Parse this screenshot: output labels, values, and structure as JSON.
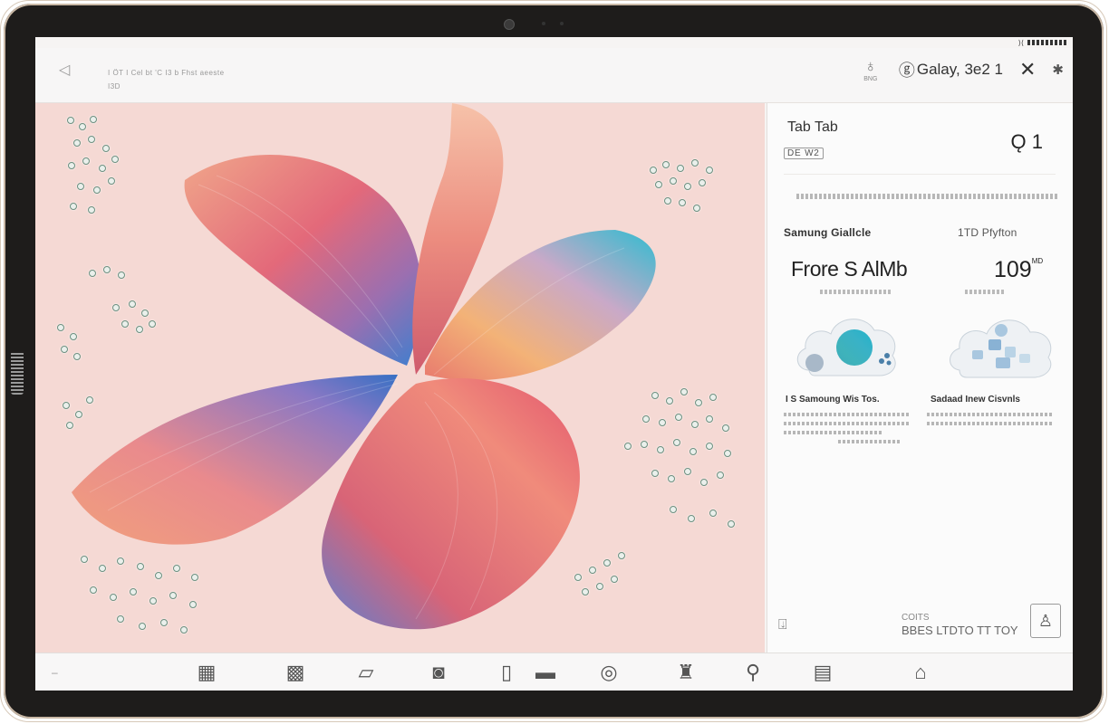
{
  "status_bar": {
    "battery": "▮▮▮▮"
  },
  "top_bar": {
    "back_icon": "back-arrow-icon",
    "breadcrumb_line1": "I ÖT I Cel bt 'C I3 b Fhst aeeste",
    "breadcrumb_line2": "I3D",
    "tip_label": "BNG",
    "account_label": "Galay, 3e2 1"
  },
  "panel": {
    "title": "Tab Tab",
    "badge": "DE W2",
    "count": "1",
    "col_left": "Samung Giallcle",
    "col_right": "1TD Pfyfton",
    "device_name": "Frore S AlMb",
    "device_value": "109",
    "device_value_unit": "MD",
    "card1_title": "I S Samoung Wis Tos.",
    "card2_title": "Sadaad Inew Cisvnls",
    "footer_line1": "COITS",
    "footer_line2": "BBES LTDTO TT TOY"
  },
  "colors": {
    "canvas_bg": "#f5d9d4",
    "bezel": "#1e1c1b",
    "accent_teal": "#1fb3c7"
  },
  "dock": {
    "icons": [
      "grid-icon",
      "table-icon",
      "folder-icon",
      "camera-icon",
      "phone-icon",
      "card-icon",
      "photo-camera-icon",
      "paint-bucket-icon",
      "brush-icon",
      "notes-icon",
      "tag-icon"
    ]
  }
}
